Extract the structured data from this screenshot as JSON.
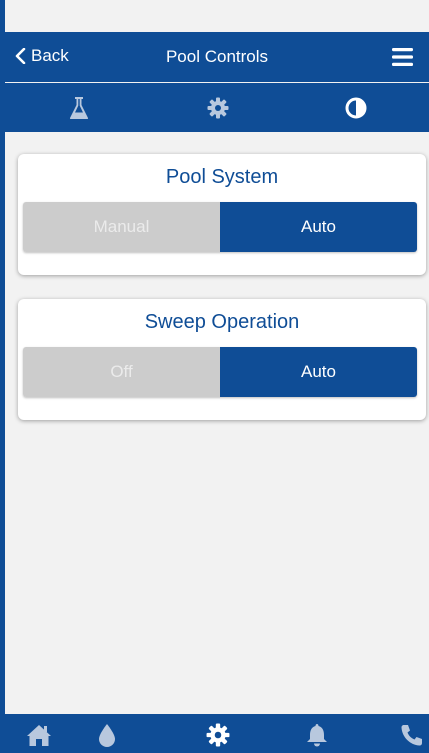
{
  "colors": {
    "primary": "#0f4d96",
    "inactive": "#cccccc",
    "inactive_text": "#ebebeb",
    "icon_inactive": "#b8c8de"
  },
  "header": {
    "back_label": "Back",
    "title": "Pool Controls"
  },
  "tabs": [
    {
      "icon": "flask-icon",
      "active": false
    },
    {
      "icon": "gear-icon",
      "active": false
    },
    {
      "icon": "contrast-icon",
      "active": true
    }
  ],
  "cards": [
    {
      "title": "Pool System",
      "options": [
        "Manual",
        "Auto"
      ],
      "selected": "Auto"
    },
    {
      "title": "Sweep Operation",
      "options": [
        "Off",
        "Auto"
      ],
      "selected": "Auto"
    }
  ],
  "bottom_nav": [
    {
      "icon": "home-icon",
      "active": false
    },
    {
      "icon": "water-drop-icon",
      "active": false
    },
    {
      "icon": "gear-icon",
      "active": true
    },
    {
      "icon": "bell-icon",
      "active": false
    },
    {
      "icon": "phone-icon",
      "active": false
    }
  ]
}
